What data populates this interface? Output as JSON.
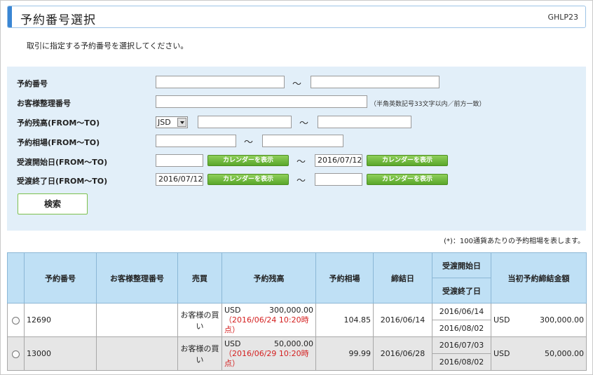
{
  "header": {
    "title": "予約番号選択",
    "screen_id": "GHLP23"
  },
  "instruction": "取引に指定する予約番号を選択してください。",
  "search": {
    "reservation_no_label": "予約番号",
    "customer_ref_label": "お客様整理番号",
    "customer_ref_note": "（半角英数記号33文字以内／前方一致）",
    "balance_label": "予約残高(FROM〜TO)",
    "balance_currency": "JSD",
    "rate_label": "予約相場(FROM〜TO)",
    "delivery_start_label": "受渡開始日(FROM〜TO)",
    "delivery_start_from": "",
    "delivery_start_to": "2016/07/12",
    "delivery_end_label": "受渡終了日(FROM〜TO)",
    "delivery_end_from": "2016/07/12",
    "delivery_end_to": "",
    "tilde": "〜",
    "calendar_label": "カレンダーを表示",
    "search_button": "検索"
  },
  "footnote": "(*)：100通貨あたりの予約相場を表します。",
  "table": {
    "headers": {
      "reservation_no": "予約番号",
      "customer_ref": "お客様整理番号",
      "side": "売買",
      "balance": "予約残高",
      "rate": "予約相場",
      "contract_date": "締結日",
      "delivery_start": "受渡開始日",
      "delivery_end": "受渡終了日",
      "initial_amount": "当初予約締結金額"
    },
    "rows": [
      {
        "reservation_no": "12690",
        "customer_ref": "",
        "side": "お客様の買い",
        "balance_ccy": "USD",
        "balance_amt": "300,000.00",
        "balance_ts": "（2016/06/24 10:20時点）",
        "rate": "104.85",
        "contract_date": "2016/06/14",
        "delivery_start": "2016/06/14",
        "delivery_end": "2016/08/02",
        "initial_ccy": "USD",
        "initial_amt": "300,000.00"
      },
      {
        "reservation_no": "13000",
        "customer_ref": "",
        "side": "お客様の買い",
        "balance_ccy": "USD",
        "balance_amt": "50,000.00",
        "balance_ts": "（2016/06/29 10:20時点）",
        "rate": "99.99",
        "contract_date": "2016/06/28",
        "delivery_start": "2016/07/03",
        "delivery_end": "2016/08/02",
        "initial_ccy": "USD",
        "initial_amt": "50,000.00"
      }
    ]
  },
  "colors": {
    "accent": "#3a86d4",
    "panel_bg": "#e2eff9",
    "header_bg": "#bfe0f5",
    "calendar_button": "#6cb83a",
    "timestamp_red": "#d42020"
  }
}
